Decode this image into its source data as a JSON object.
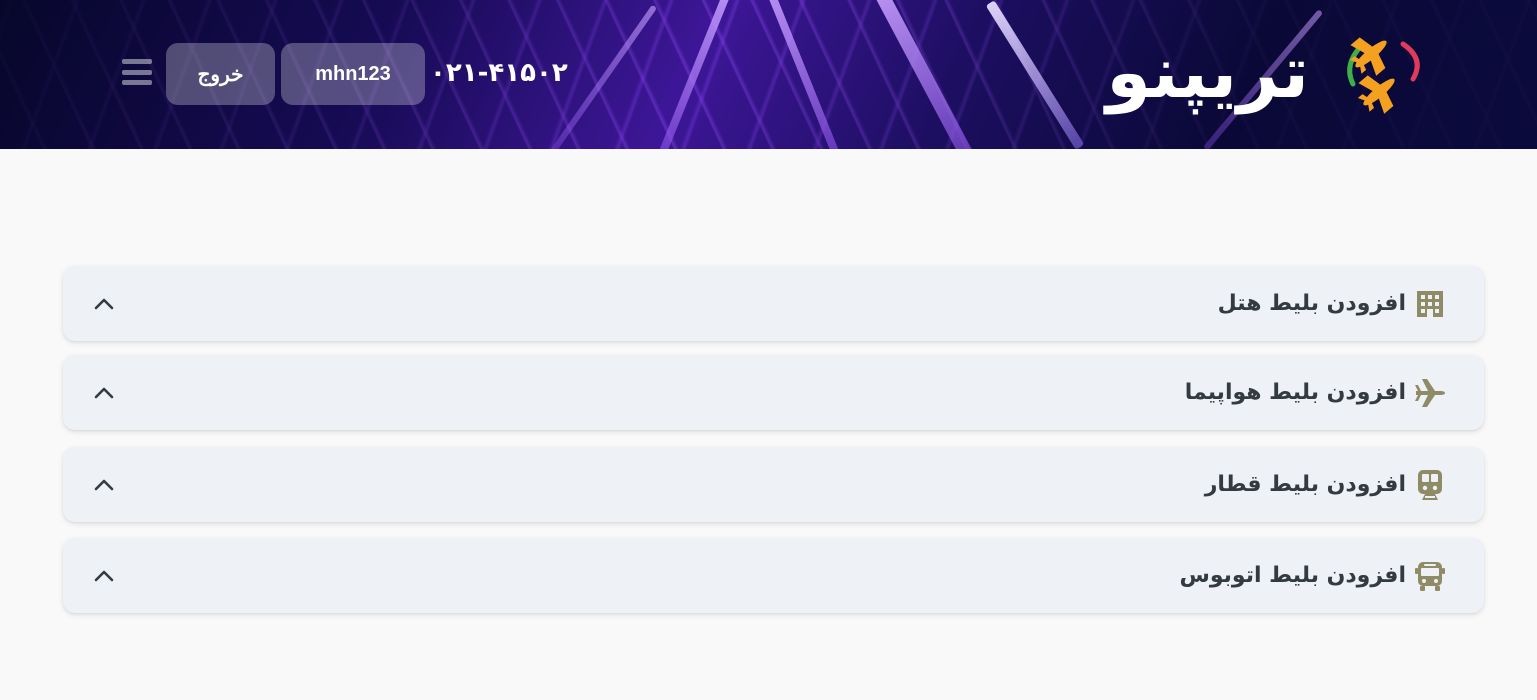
{
  "header": {
    "brand": "تریپنو",
    "phone": "۰۲۱-۴۱۵۰۲",
    "user_label": "mhn123",
    "logout_label": "خروج",
    "menu_icon": "hamburger-menu-icon",
    "logo_icon": "airplanes-logo-icon"
  },
  "panels": [
    {
      "label": "افزودن بلیط هتل",
      "icon": "hotel-icon"
    },
    {
      "label": "افزودن بلیط هواپیما",
      "icon": "airplane-icon"
    },
    {
      "label": "افزودن بلیط قطار",
      "icon": "train-icon"
    },
    {
      "label": "افزودن بلیط اتوبوس",
      "icon": "bus-icon"
    }
  ],
  "colors": {
    "icon": "#8f8b67",
    "panel_bg": "#eef1f6",
    "page_bg": "#f9f9f9",
    "header_bg": "#1a0d5c",
    "logo_plane": "#f4a020"
  }
}
